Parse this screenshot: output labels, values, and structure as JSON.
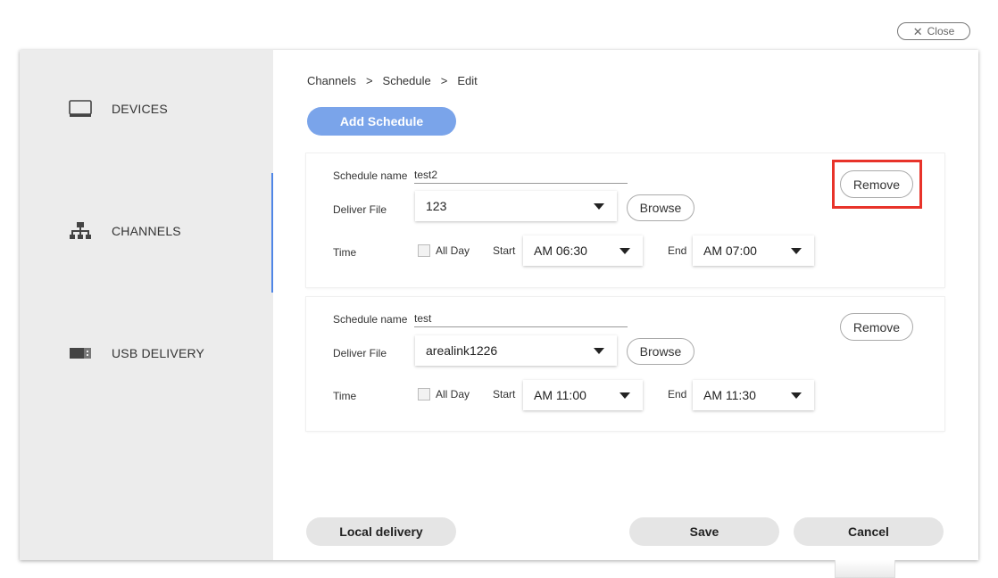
{
  "close": {
    "label": "Close"
  },
  "sidebar": {
    "items": [
      {
        "label": "DEVICES",
        "icon": "monitor-icon",
        "active": false
      },
      {
        "label": "CHANNELS",
        "icon": "network-icon",
        "active": true
      },
      {
        "label": "USB DELIVERY",
        "icon": "usb-drive-icon",
        "active": false
      }
    ]
  },
  "breadcrumb": {
    "items": [
      "Channels",
      "Schedule",
      "Edit"
    ],
    "separator": ">"
  },
  "add_schedule_label": "Add Schedule",
  "labels": {
    "schedule_name": "Schedule name",
    "deliver_file": "Deliver File",
    "time": "Time",
    "all_day": "All Day",
    "start": "Start",
    "end": "End",
    "browse": "Browse",
    "remove": "Remove"
  },
  "schedules": [
    {
      "name": "test2",
      "file": "123",
      "all_day": false,
      "start": "AM 06:30",
      "end": "AM 07:00",
      "remove_highlighted": true
    },
    {
      "name": "test",
      "file": "arealink1226",
      "all_day": false,
      "start": "AM 11:00",
      "end": "AM 11:30",
      "remove_highlighted": false
    }
  ],
  "footer": {
    "local_delivery": "Local delivery",
    "save": "Save",
    "cancel": "Cancel"
  },
  "colors": {
    "accent": "#4f86e6",
    "primary_button": "#7aa4ea",
    "highlight": "#e8332a",
    "sidebar_bg": "#ececec"
  }
}
